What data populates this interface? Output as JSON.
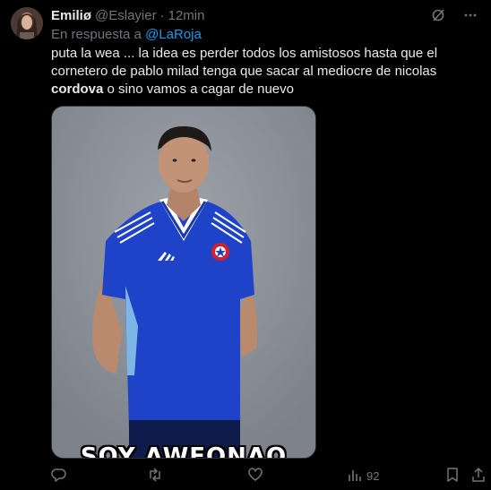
{
  "tweet": {
    "author_name": "Emiliø",
    "author_handle": "@Eslayier",
    "separator": "·",
    "time": "12min",
    "reply_prefix": "En respuesta a",
    "reply_mention": "@LaRoja",
    "text_part1": "puta la wea ... la idea es perder todos los amistosos hasta que el cornetero de pablo milad tenga que sacar al mediocre de nicolas",
    "text_bold": "cordova",
    "text_part2": "o sino vamos a cagar de nuevo",
    "media_caption": "SOY AWEONAO"
  },
  "actions": {
    "views_count": "92"
  },
  "icons": [
    "grok-icon",
    "more-icon",
    "reply-icon",
    "retweet-icon",
    "like-icon",
    "views-icon",
    "bookmark-icon",
    "share-icon"
  ],
  "colors": {
    "background": "#000000",
    "text": "#e7e9ea",
    "muted": "#71767b",
    "link": "#1d9bf0",
    "jersey": "#1f43c8"
  }
}
